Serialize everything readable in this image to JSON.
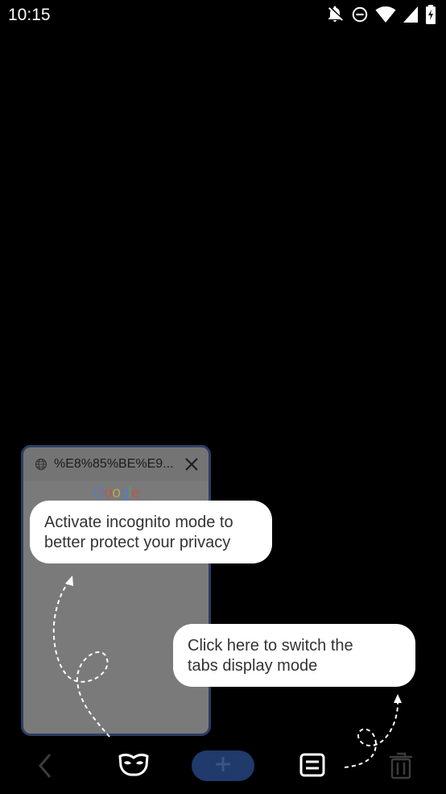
{
  "status_bar": {
    "time": "10:15",
    "icons": [
      "notifications-off-icon",
      "do-not-disturb-icon",
      "wifi-icon",
      "signal-icon",
      "battery-icon"
    ]
  },
  "tab_card": {
    "title": "%E8%85%BE%E9...",
    "favicon": "globe-icon",
    "close_icon": "close-icon",
    "preview_logo": [
      "G",
      "o",
      "o",
      "g",
      "l",
      "e"
    ]
  },
  "tooltips": {
    "incognito": {
      "line1": "Activate incognito mode to",
      "line2": "better protect your privacy"
    },
    "display_mode": {
      "line1": "Click here to switch the",
      "line2": "tabs display mode"
    }
  },
  "bottom_bar": {
    "back_icon": "chevron-left-icon",
    "incognito_icon": "mask-icon",
    "add_icon": "plus-icon",
    "display_mode_icon": "list-view-icon",
    "trash_icon": "trash-icon"
  },
  "colors": {
    "background": "#000000",
    "card_border": "#2b3e63",
    "card_fill": "#7a7a7a",
    "add_button": "#1f3a6b",
    "tooltip": "#ffffff"
  }
}
